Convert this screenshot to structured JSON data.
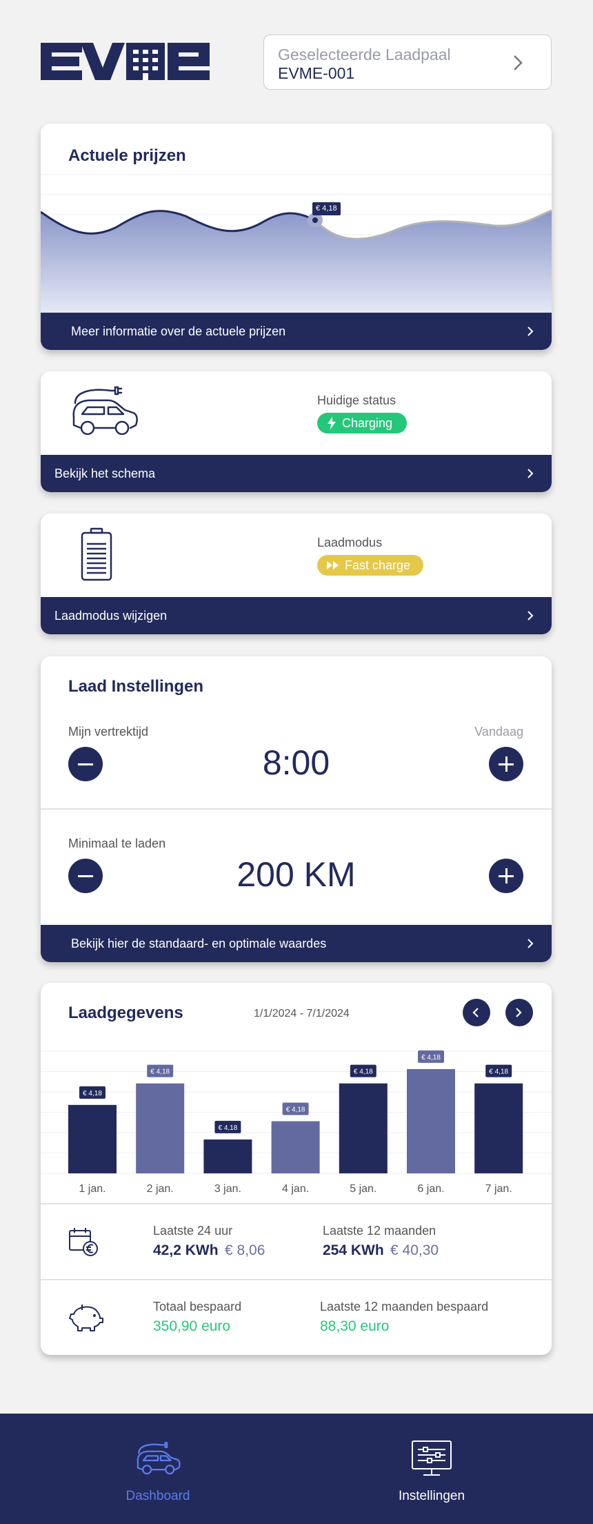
{
  "header": {
    "logo_text": "EVME",
    "station_label": "Geselecteerde Laadpaal",
    "station_value": "EVME-001"
  },
  "prices_card": {
    "title": "Actuele prijzen",
    "price_tag": "€ 4,18",
    "footer": "Meer informatie over de actuele prijzen"
  },
  "status_card": {
    "label": "Huidige status",
    "status": "Charging",
    "status_color": "#25c77b",
    "footer": "Bekijk het schema"
  },
  "mode_card": {
    "label": "Laadmodus",
    "mode": "Fast charge",
    "mode_color": "#e5c84a",
    "footer": "Laadmodus wijzigen"
  },
  "settings_card": {
    "title": "Laad Instellingen",
    "departure_label": "Mijn vertrektijd",
    "departure_day": "Vandaag",
    "departure_value": "8:00",
    "min_label": "Minimaal te laden",
    "min_value": "200 KM",
    "footer": "Bekijk hier de standaard- en optimale waardes"
  },
  "data_card": {
    "title": "Laadgegevens",
    "date_range": "1/1/2024 - 7/1/2024",
    "stats": {
      "last24_label": "Laatste 24 uur",
      "last24_kwh": "42,2 KWh",
      "last24_eur": "€ 8,06",
      "last12_label": "Laatste 12 maanden",
      "last12_kwh": "254 KWh",
      "last12_eur": "€ 40,30",
      "saved_label": "Totaal bespaard",
      "saved_value": "350,90 euro",
      "saved12_label": "Laatste 12 maanden bespaard",
      "saved12_value": "88,30 euro"
    }
  },
  "chart_data": {
    "type": "bar",
    "categories": [
      "1 jan.",
      "2 jan.",
      "3 jan.",
      "4 jan.",
      "5 jan.",
      "6 jan.",
      "7 jan."
    ],
    "values": [
      105,
      138,
      52,
      80,
      138,
      160,
      138
    ],
    "data_labels": [
      "€ 4,18",
      "€ 4,18",
      "€ 4,18",
      "€ 4,18",
      "€ 4,18",
      "€ 4,18",
      "€ 4,18"
    ],
    "bar_colors": [
      "#222a5c",
      "#636a9f",
      "#222a5c",
      "#636a9f",
      "#222a5c",
      "#636a9f",
      "#222a5c"
    ],
    "ylim": [
      0,
      180
    ],
    "grid": true
  },
  "bottom_nav": {
    "dashboard": "Dashboard",
    "settings": "Instellingen",
    "active_color": "#5b7be8"
  }
}
